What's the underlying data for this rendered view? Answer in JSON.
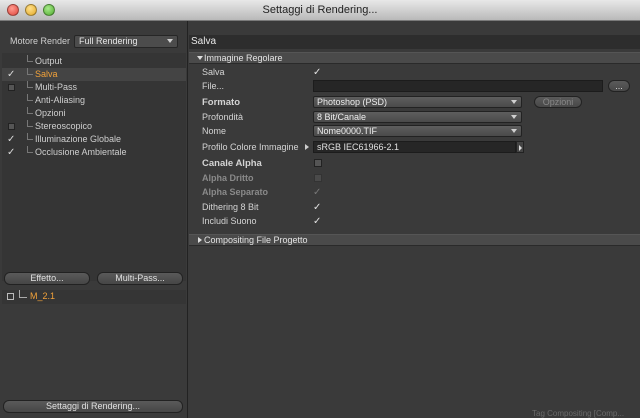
{
  "window": {
    "title": "Settaggi di Rendering..."
  },
  "left": {
    "engine_label": "Motore Render",
    "engine_value": "Full Rendering",
    "items": [
      {
        "label": "Output",
        "checked": ""
      },
      {
        "label": "Salva",
        "checked": "✓"
      },
      {
        "label": "Multi-Pass",
        "checked": ""
      },
      {
        "label": "Anti-Aliasing",
        "checked": ""
      },
      {
        "label": "Opzioni",
        "checked": ""
      },
      {
        "label": "Stereoscopico",
        "checked": ""
      },
      {
        "label": "Illuminazione Globale",
        "checked": "✓"
      },
      {
        "label": "Occlusione Ambientale",
        "checked": "✓"
      }
    ],
    "effect_button": "Effetto...",
    "multipass_button": "Multi-Pass...",
    "preset_name": "M_2.1",
    "render_settings_button": "Settaggi di Rendering..."
  },
  "right": {
    "panel_title": "Salva",
    "section_regular": "Immagine Regolare",
    "rows": {
      "salva": {
        "label": "Salva",
        "value": "✓"
      },
      "file": {
        "label": "File...",
        "button": "..."
      },
      "formato": {
        "label": "Formato",
        "value": "Photoshop (PSD)",
        "options_button": "Opzioni"
      },
      "profondita": {
        "label": "Profondità",
        "value": "8 Bit/Canale"
      },
      "nome": {
        "label": "Nome",
        "value": "Nome0000.TIF"
      },
      "profilo": {
        "label": "Profilo Colore Immagine",
        "value": "sRGB IEC61966-2.1"
      },
      "canale_alpha": {
        "label": "Canale Alpha"
      },
      "alpha_dritto": {
        "label": "Alpha Dritto"
      },
      "alpha_separato": {
        "label": "Alpha Separato",
        "value": "✓"
      },
      "dithering": {
        "label": "Dithering 8 Bit",
        "value": "✓"
      },
      "suono": {
        "label": "Includi Suono",
        "value": "✓"
      }
    },
    "section_compositing": "Compositing File Progetto"
  },
  "status_text": "Tag Compositing [Comp..."
}
